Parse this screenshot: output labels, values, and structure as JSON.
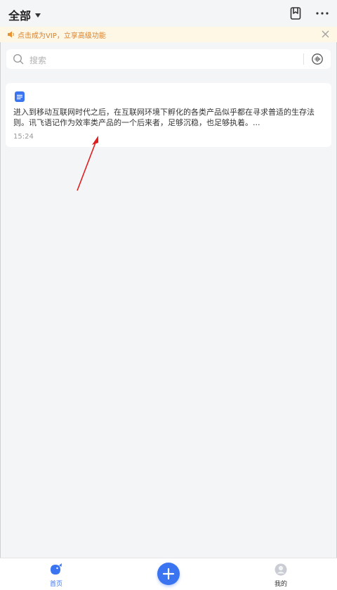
{
  "header": {
    "filter_label": "全部"
  },
  "vip_banner": {
    "text": "点击成为VIP，立享高级功能"
  },
  "search": {
    "placeholder": "搜索"
  },
  "notes": [
    {
      "text": "进入到移动互联网时代之后，在互联网环境下孵化的各类产品似乎都在寻求普适的生存法则。讯飞语记作为效率类产品的一个后来者，足够沉稳，也足够执着。...",
      "time": "15:24"
    }
  ],
  "bottom_nav": {
    "home_label": "首页",
    "mine_label": "我的"
  },
  "colors": {
    "accent": "#3b74f0",
    "vip_text": "#d9822b",
    "vip_background": "#fff7e6",
    "annotation_arrow": "#e02020"
  },
  "icons": [
    "chevron-down-icon",
    "bookmark-icon",
    "more-icon",
    "speaker-icon",
    "close-icon",
    "search-icon",
    "voice-input-icon",
    "document-icon",
    "home-icon",
    "plus-icon",
    "avatar-icon"
  ]
}
